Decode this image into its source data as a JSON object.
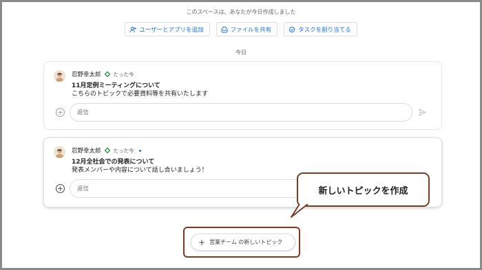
{
  "space_notice": "このスペースは、あなたが今日作成しました",
  "actions": [
    {
      "label": "ユーザーとアプリを追加",
      "icon": "add-person-icon"
    },
    {
      "label": "ファイルを共有",
      "icon": "drive-icon"
    },
    {
      "label": "タスクを割り当てる",
      "icon": "task-icon"
    }
  ],
  "date_divider": "今日",
  "messages": [
    {
      "author": "忍野幸太郎",
      "time": "たった今",
      "title": "11月定例ミーティングについて",
      "body": "こちらのトピックで必要資料等を共有いたします",
      "reply_placeholder": "返信"
    },
    {
      "author": "忍野幸太郎",
      "time": "たった今",
      "title": "12月全社会での発表について",
      "body": "発表メンバーや内容について話し合いましょう！",
      "reply_placeholder": "返信"
    }
  ],
  "callout": "新しいトピックを作成",
  "new_topic_button": "営業チーム の新しいトピック",
  "colors": {
    "accent": "#1a73e8",
    "callout_border": "#7a3b22",
    "badge_green": "#1e8e3e"
  }
}
